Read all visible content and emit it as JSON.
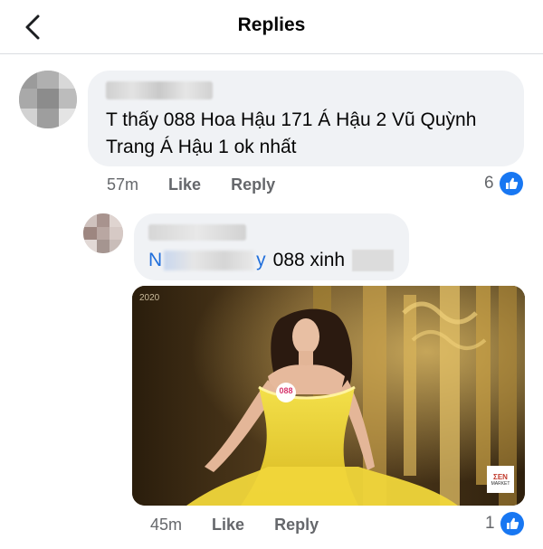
{
  "header": {
    "title": "Replies"
  },
  "comment1": {
    "text": "T thấy 088 Hoa Hậu 171 Á Hậu 2 Vũ Quỳnh Trang Á Hậu 1 ok nhất",
    "time": "57m",
    "like_label": "Like",
    "reply_label": "Reply",
    "reaction_count": "6"
  },
  "reply1": {
    "mention_start": "N",
    "mention_end": "y",
    "text": "088 xinh",
    "video_tag": "2020",
    "badge": "088",
    "logo_line1": "ΣEN",
    "logo_line2": "MARKET",
    "time": "45m",
    "like_label": "Like",
    "reply_label": "Reply",
    "reaction_count": "1"
  },
  "colors": {
    "accent": "#1877f2",
    "bubble": "#f0f2f5",
    "meta": "#65676b",
    "mention": "#216fdb"
  }
}
